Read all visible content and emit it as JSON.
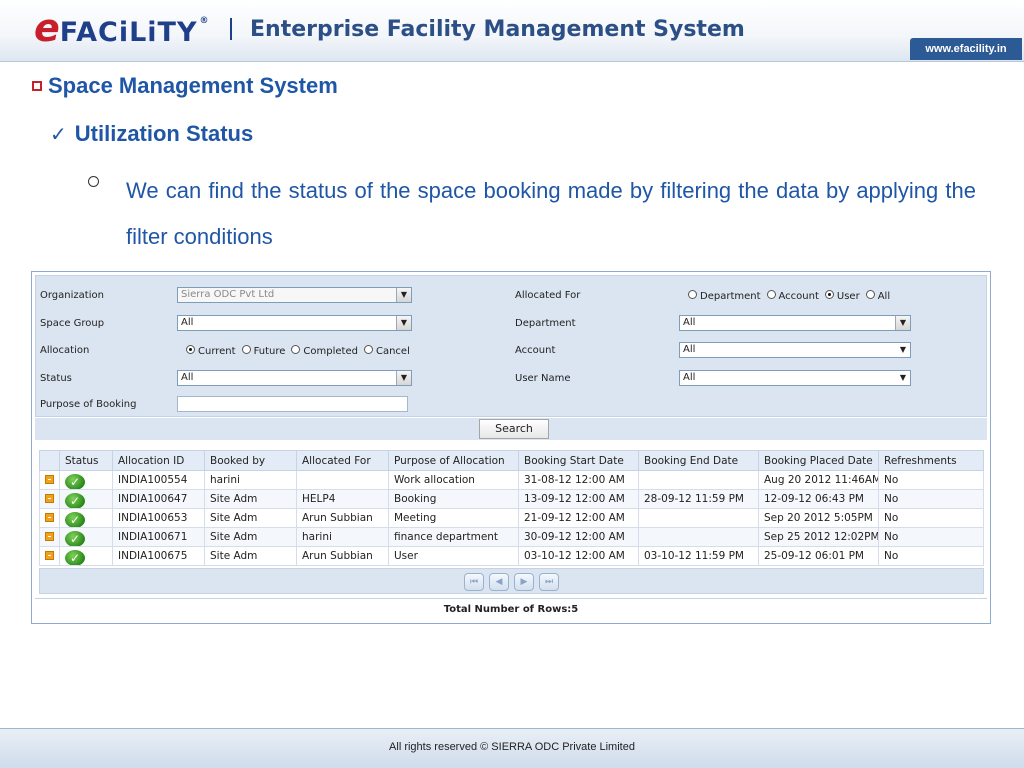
{
  "header": {
    "logo_e": "e",
    "logo_rest": "FACiLiTY",
    "logo_reg": "®",
    "title": "Enterprise Facility Management System",
    "url": "www.efacility.in"
  },
  "slide": {
    "heading": "Space Management System",
    "subheading": "Utilization Status",
    "paragraph": "We can find the status of the space booking made by filtering the data by applying the filter conditions"
  },
  "filters": {
    "organization_label": "Organization",
    "organization_value": "Sierra ODC Pvt Ltd",
    "space_group_label": "Space Group",
    "space_group_value": "All",
    "allocation_label": "Allocation",
    "allocation_options": [
      "Current",
      "Future",
      "Completed",
      "Cancel"
    ],
    "allocation_selected": "Current",
    "status_label": "Status",
    "status_value": "All",
    "purpose_label": "Purpose of Booking",
    "purpose_value": "",
    "allocated_for_label": "Allocated For",
    "allocated_for_options": [
      "Department",
      "Account",
      "User",
      "All"
    ],
    "allocated_for_selected": "User",
    "department_label": "Department",
    "department_value": "All",
    "account_label": "Account",
    "account_value": "All",
    "user_name_label": "User Name",
    "user_name_value": "All",
    "search_label": "Search"
  },
  "table": {
    "columns": [
      "",
      "Status",
      "Allocation ID",
      "Booked by",
      "Allocated For",
      "Purpose of Allocation",
      "Booking Start Date",
      "Booking End Date",
      "Booking Placed Date",
      "Refreshments"
    ],
    "rows": [
      [
        "INDIA100554",
        "harini",
        "",
        "Work allocation",
        "31-08-12 12:00 AM",
        "",
        "Aug 20 2012 11:46AM",
        "No"
      ],
      [
        "INDIA100647",
        "Site Adm",
        "HELP4",
        "Booking",
        "13-09-12 12:00 AM",
        "28-09-12 11:59 PM",
        "12-09-12 06:43 PM",
        "No"
      ],
      [
        "INDIA100653",
        "Site Adm",
        "Arun Subbian",
        "Meeting",
        "21-09-12 12:00 AM",
        "",
        "Sep 20 2012 5:05PM",
        "No"
      ],
      [
        "INDIA100671",
        "Site Adm",
        "harini",
        "finance department",
        "30-09-12 12:00 AM",
        "",
        "Sep 25 2012 12:02PM",
        "No"
      ],
      [
        "INDIA100675",
        "Site Adm",
        "Arun Subbian",
        "User",
        "03-10-12 12:00 AM",
        "03-10-12 11:59 PM",
        "25-09-12 06:01 PM",
        "No"
      ]
    ]
  },
  "total_rows": "Total Number of Rows:5",
  "footer": "All rights reserved © SIERRA ODC Private Limited",
  "colors": {
    "brand_red": "#c8202a",
    "brand_blue": "#1f56a6",
    "panel": "#dbe5f1"
  }
}
